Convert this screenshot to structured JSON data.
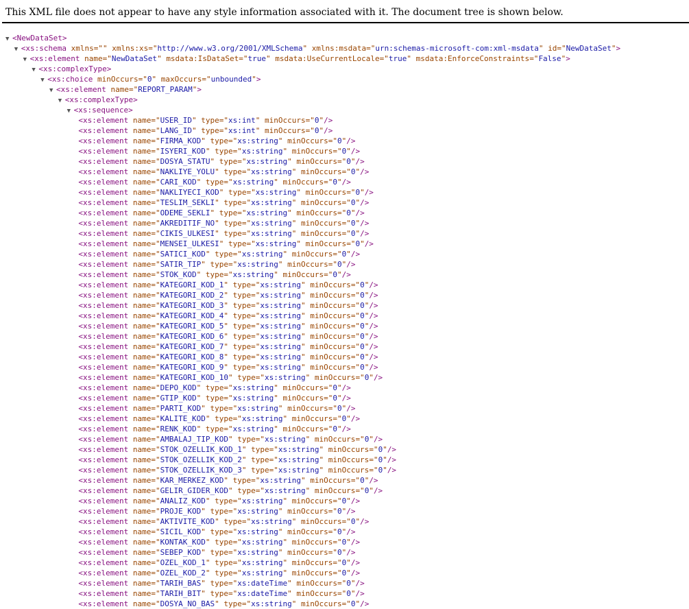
{
  "header": {
    "text": "This XML file does not appear to have any style information associated with it. The document tree is shown below."
  },
  "colors": {
    "tag": "#881280",
    "attribute": "#994500",
    "value": "#1a1aa6",
    "toggle": "#555555"
  },
  "icons": {
    "toggle": "triangle-down-icon"
  },
  "tree": {
    "lines": [
      {
        "indent": 0,
        "toggle": true,
        "tag": "NewDataSet",
        "attrs": [],
        "selfClose": false
      },
      {
        "indent": 1,
        "toggle": true,
        "tag": "xs:schema",
        "attrs": [
          [
            "xmlns",
            ""
          ],
          [
            "xmlns:xs",
            "http://www.w3.org/2001/XMLSchema"
          ],
          [
            "xmlns:msdata",
            "urn:schemas-microsoft-com:xml-msdata"
          ],
          [
            "id",
            "NewDataSet"
          ]
        ],
        "selfClose": false
      },
      {
        "indent": 2,
        "toggle": true,
        "tag": "xs:element",
        "attrs": [
          [
            "name",
            "NewDataSet"
          ],
          [
            "msdata:IsDataSet",
            "true"
          ],
          [
            "msdata:UseCurrentLocale",
            "true"
          ],
          [
            "msdata:EnforceConstraints",
            "False"
          ]
        ],
        "selfClose": false
      },
      {
        "indent": 3,
        "toggle": true,
        "tag": "xs:complexType",
        "attrs": [],
        "selfClose": false
      },
      {
        "indent": 4,
        "toggle": true,
        "tag": "xs:choice",
        "attrs": [
          [
            "minOccurs",
            "0"
          ],
          [
            "maxOccurs",
            "unbounded"
          ]
        ],
        "selfClose": false
      },
      {
        "indent": 5,
        "toggle": true,
        "tag": "xs:element",
        "attrs": [
          [
            "name",
            "REPORT_PARAM"
          ]
        ],
        "selfClose": false
      },
      {
        "indent": 6,
        "toggle": true,
        "tag": "xs:complexType",
        "attrs": [],
        "selfClose": false
      },
      {
        "indent": 7,
        "toggle": true,
        "tag": "xs:sequence",
        "attrs": [],
        "selfClose": false
      },
      {
        "indent": 8,
        "toggle": false,
        "tag": "xs:element",
        "attrs": [
          [
            "name",
            "USER_ID"
          ],
          [
            "type",
            "xs:int"
          ],
          [
            "minOccurs",
            "0"
          ]
        ],
        "selfClose": true
      },
      {
        "indent": 8,
        "toggle": false,
        "tag": "xs:element",
        "attrs": [
          [
            "name",
            "LANG_ID"
          ],
          [
            "type",
            "xs:int"
          ],
          [
            "minOccurs",
            "0"
          ]
        ],
        "selfClose": true
      },
      {
        "indent": 8,
        "toggle": false,
        "tag": "xs:element",
        "attrs": [
          [
            "name",
            "FIRMA_KOD"
          ],
          [
            "type",
            "xs:string"
          ],
          [
            "minOccurs",
            "0"
          ]
        ],
        "selfClose": true
      },
      {
        "indent": 8,
        "toggle": false,
        "tag": "xs:element",
        "attrs": [
          [
            "name",
            "ISYERI_KOD"
          ],
          [
            "type",
            "xs:string"
          ],
          [
            "minOccurs",
            "0"
          ]
        ],
        "selfClose": true
      },
      {
        "indent": 8,
        "toggle": false,
        "tag": "xs:element",
        "attrs": [
          [
            "name",
            "DOSYA_STATU"
          ],
          [
            "type",
            "xs:string"
          ],
          [
            "minOccurs",
            "0"
          ]
        ],
        "selfClose": true
      },
      {
        "indent": 8,
        "toggle": false,
        "tag": "xs:element",
        "attrs": [
          [
            "name",
            "NAKLIYE_YOLU"
          ],
          [
            "type",
            "xs:string"
          ],
          [
            "minOccurs",
            "0"
          ]
        ],
        "selfClose": true
      },
      {
        "indent": 8,
        "toggle": false,
        "tag": "xs:element",
        "attrs": [
          [
            "name",
            "CARI_KOD"
          ],
          [
            "type",
            "xs:string"
          ],
          [
            "minOccurs",
            "0"
          ]
        ],
        "selfClose": true
      },
      {
        "indent": 8,
        "toggle": false,
        "tag": "xs:element",
        "attrs": [
          [
            "name",
            "NAKLIYECI_KOD"
          ],
          [
            "type",
            "xs:string"
          ],
          [
            "minOccurs",
            "0"
          ]
        ],
        "selfClose": true
      },
      {
        "indent": 8,
        "toggle": false,
        "tag": "xs:element",
        "attrs": [
          [
            "name",
            "TESLIM_SEKLI"
          ],
          [
            "type",
            "xs:string"
          ],
          [
            "minOccurs",
            "0"
          ]
        ],
        "selfClose": true
      },
      {
        "indent": 8,
        "toggle": false,
        "tag": "xs:element",
        "attrs": [
          [
            "name",
            "ODEME_SEKLI"
          ],
          [
            "type",
            "xs:string"
          ],
          [
            "minOccurs",
            "0"
          ]
        ],
        "selfClose": true
      },
      {
        "indent": 8,
        "toggle": false,
        "tag": "xs:element",
        "attrs": [
          [
            "name",
            "AKREDITIF_NO"
          ],
          [
            "type",
            "xs:string"
          ],
          [
            "minOccurs",
            "0"
          ]
        ],
        "selfClose": true
      },
      {
        "indent": 8,
        "toggle": false,
        "tag": "xs:element",
        "attrs": [
          [
            "name",
            "CIKIS_ULKESI"
          ],
          [
            "type",
            "xs:string"
          ],
          [
            "minOccurs",
            "0"
          ]
        ],
        "selfClose": true
      },
      {
        "indent": 8,
        "toggle": false,
        "tag": "xs:element",
        "attrs": [
          [
            "name",
            "MENSEI_ULKESI"
          ],
          [
            "type",
            "xs:string"
          ],
          [
            "minOccurs",
            "0"
          ]
        ],
        "selfClose": true
      },
      {
        "indent": 8,
        "toggle": false,
        "tag": "xs:element",
        "attrs": [
          [
            "name",
            "SATICI_KOD"
          ],
          [
            "type",
            "xs:string"
          ],
          [
            "minOccurs",
            "0"
          ]
        ],
        "selfClose": true
      },
      {
        "indent": 8,
        "toggle": false,
        "tag": "xs:element",
        "attrs": [
          [
            "name",
            "SATIR_TIP"
          ],
          [
            "type",
            "xs:string"
          ],
          [
            "minOccurs",
            "0"
          ]
        ],
        "selfClose": true
      },
      {
        "indent": 8,
        "toggle": false,
        "tag": "xs:element",
        "attrs": [
          [
            "name",
            "STOK_KOD"
          ],
          [
            "type",
            "xs:string"
          ],
          [
            "minOccurs",
            "0"
          ]
        ],
        "selfClose": true
      },
      {
        "indent": 8,
        "toggle": false,
        "tag": "xs:element",
        "attrs": [
          [
            "name",
            "KATEGORI_KOD_1"
          ],
          [
            "type",
            "xs:string"
          ],
          [
            "minOccurs",
            "0"
          ]
        ],
        "selfClose": true
      },
      {
        "indent": 8,
        "toggle": false,
        "tag": "xs:element",
        "attrs": [
          [
            "name",
            "KATEGORI_KOD_2"
          ],
          [
            "type",
            "xs:string"
          ],
          [
            "minOccurs",
            "0"
          ]
        ],
        "selfClose": true
      },
      {
        "indent": 8,
        "toggle": false,
        "tag": "xs:element",
        "attrs": [
          [
            "name",
            "KATEGORI_KOD_3"
          ],
          [
            "type",
            "xs:string"
          ],
          [
            "minOccurs",
            "0"
          ]
        ],
        "selfClose": true
      },
      {
        "indent": 8,
        "toggle": false,
        "tag": "xs:element",
        "attrs": [
          [
            "name",
            "KATEGORI_KOD_4"
          ],
          [
            "type",
            "xs:string"
          ],
          [
            "minOccurs",
            "0"
          ]
        ],
        "selfClose": true
      },
      {
        "indent": 8,
        "toggle": false,
        "tag": "xs:element",
        "attrs": [
          [
            "name",
            "KATEGORI_KOD_5"
          ],
          [
            "type",
            "xs:string"
          ],
          [
            "minOccurs",
            "0"
          ]
        ],
        "selfClose": true
      },
      {
        "indent": 8,
        "toggle": false,
        "tag": "xs:element",
        "attrs": [
          [
            "name",
            "KATEGORI_KOD_6"
          ],
          [
            "type",
            "xs:string"
          ],
          [
            "minOccurs",
            "0"
          ]
        ],
        "selfClose": true
      },
      {
        "indent": 8,
        "toggle": false,
        "tag": "xs:element",
        "attrs": [
          [
            "name",
            "KATEGORI_KOD_7"
          ],
          [
            "type",
            "xs:string"
          ],
          [
            "minOccurs",
            "0"
          ]
        ],
        "selfClose": true
      },
      {
        "indent": 8,
        "toggle": false,
        "tag": "xs:element",
        "attrs": [
          [
            "name",
            "KATEGORI_KOD_8"
          ],
          [
            "type",
            "xs:string"
          ],
          [
            "minOccurs",
            "0"
          ]
        ],
        "selfClose": true
      },
      {
        "indent": 8,
        "toggle": false,
        "tag": "xs:element",
        "attrs": [
          [
            "name",
            "KATEGORI_KOD_9"
          ],
          [
            "type",
            "xs:string"
          ],
          [
            "minOccurs",
            "0"
          ]
        ],
        "selfClose": true
      },
      {
        "indent": 8,
        "toggle": false,
        "tag": "xs:element",
        "attrs": [
          [
            "name",
            "KATEGORI_KOD_10"
          ],
          [
            "type",
            "xs:string"
          ],
          [
            "minOccurs",
            "0"
          ]
        ],
        "selfClose": true
      },
      {
        "indent": 8,
        "toggle": false,
        "tag": "xs:element",
        "attrs": [
          [
            "name",
            "DEPO_KOD"
          ],
          [
            "type",
            "xs:string"
          ],
          [
            "minOccurs",
            "0"
          ]
        ],
        "selfClose": true
      },
      {
        "indent": 8,
        "toggle": false,
        "tag": "xs:element",
        "attrs": [
          [
            "name",
            "GTIP_KOD"
          ],
          [
            "type",
            "xs:string"
          ],
          [
            "minOccurs",
            "0"
          ]
        ],
        "selfClose": true
      },
      {
        "indent": 8,
        "toggle": false,
        "tag": "xs:element",
        "attrs": [
          [
            "name",
            "PARTI_KOD"
          ],
          [
            "type",
            "xs:string"
          ],
          [
            "minOccurs",
            "0"
          ]
        ],
        "selfClose": true
      },
      {
        "indent": 8,
        "toggle": false,
        "tag": "xs:element",
        "attrs": [
          [
            "name",
            "KALITE_KOD"
          ],
          [
            "type",
            "xs:string"
          ],
          [
            "minOccurs",
            "0"
          ]
        ],
        "selfClose": true
      },
      {
        "indent": 8,
        "toggle": false,
        "tag": "xs:element",
        "attrs": [
          [
            "name",
            "RENK_KOD"
          ],
          [
            "type",
            "xs:string"
          ],
          [
            "minOccurs",
            "0"
          ]
        ],
        "selfClose": true
      },
      {
        "indent": 8,
        "toggle": false,
        "tag": "xs:element",
        "attrs": [
          [
            "name",
            "AMBALAJ_TIP_KOD"
          ],
          [
            "type",
            "xs:string"
          ],
          [
            "minOccurs",
            "0"
          ]
        ],
        "selfClose": true
      },
      {
        "indent": 8,
        "toggle": false,
        "tag": "xs:element",
        "attrs": [
          [
            "name",
            "STOK_OZELLIK_KOD_1"
          ],
          [
            "type",
            "xs:string"
          ],
          [
            "minOccurs",
            "0"
          ]
        ],
        "selfClose": true
      },
      {
        "indent": 8,
        "toggle": false,
        "tag": "xs:element",
        "attrs": [
          [
            "name",
            "STOK_OZELLIK_KOD_2"
          ],
          [
            "type",
            "xs:string"
          ],
          [
            "minOccurs",
            "0"
          ]
        ],
        "selfClose": true
      },
      {
        "indent": 8,
        "toggle": false,
        "tag": "xs:element",
        "attrs": [
          [
            "name",
            "STOK_OZELLIK_KOD_3"
          ],
          [
            "type",
            "xs:string"
          ],
          [
            "minOccurs",
            "0"
          ]
        ],
        "selfClose": true
      },
      {
        "indent": 8,
        "toggle": false,
        "tag": "xs:element",
        "attrs": [
          [
            "name",
            "KAR_MERKEZ_KOD"
          ],
          [
            "type",
            "xs:string"
          ],
          [
            "minOccurs",
            "0"
          ]
        ],
        "selfClose": true
      },
      {
        "indent": 8,
        "toggle": false,
        "tag": "xs:element",
        "attrs": [
          [
            "name",
            "GELIR_GIDER_KOD"
          ],
          [
            "type",
            "xs:string"
          ],
          [
            "minOccurs",
            "0"
          ]
        ],
        "selfClose": true
      },
      {
        "indent": 8,
        "toggle": false,
        "tag": "xs:element",
        "attrs": [
          [
            "name",
            "ANALIZ_KOD"
          ],
          [
            "type",
            "xs:string"
          ],
          [
            "minOccurs",
            "0"
          ]
        ],
        "selfClose": true
      },
      {
        "indent": 8,
        "toggle": false,
        "tag": "xs:element",
        "attrs": [
          [
            "name",
            "PROJE_KOD"
          ],
          [
            "type",
            "xs:string"
          ],
          [
            "minOccurs",
            "0"
          ]
        ],
        "selfClose": true
      },
      {
        "indent": 8,
        "toggle": false,
        "tag": "xs:element",
        "attrs": [
          [
            "name",
            "AKTIVITE_KOD"
          ],
          [
            "type",
            "xs:string"
          ],
          [
            "minOccurs",
            "0"
          ]
        ],
        "selfClose": true
      },
      {
        "indent": 8,
        "toggle": false,
        "tag": "xs:element",
        "attrs": [
          [
            "name",
            "SICIL_KOD"
          ],
          [
            "type",
            "xs:string"
          ],
          [
            "minOccurs",
            "0"
          ]
        ],
        "selfClose": true
      },
      {
        "indent": 8,
        "toggle": false,
        "tag": "xs:element",
        "attrs": [
          [
            "name",
            "KONTAK_KOD"
          ],
          [
            "type",
            "xs:string"
          ],
          [
            "minOccurs",
            "0"
          ]
        ],
        "selfClose": true
      },
      {
        "indent": 8,
        "toggle": false,
        "tag": "xs:element",
        "attrs": [
          [
            "name",
            "SEBEP_KOD"
          ],
          [
            "type",
            "xs:string"
          ],
          [
            "minOccurs",
            "0"
          ]
        ],
        "selfClose": true
      },
      {
        "indent": 8,
        "toggle": false,
        "tag": "xs:element",
        "attrs": [
          [
            "name",
            "OZEL_KOD_1"
          ],
          [
            "type",
            "xs:string"
          ],
          [
            "minOccurs",
            "0"
          ]
        ],
        "selfClose": true
      },
      {
        "indent": 8,
        "toggle": false,
        "tag": "xs:element",
        "attrs": [
          [
            "name",
            "OZEL_KOD_2"
          ],
          [
            "type",
            "xs:string"
          ],
          [
            "minOccurs",
            "0"
          ]
        ],
        "selfClose": true
      },
      {
        "indent": 8,
        "toggle": false,
        "tag": "xs:element",
        "attrs": [
          [
            "name",
            "TARIH_BAS"
          ],
          [
            "type",
            "xs:dateTime"
          ],
          [
            "minOccurs",
            "0"
          ]
        ],
        "selfClose": true
      },
      {
        "indent": 8,
        "toggle": false,
        "tag": "xs:element",
        "attrs": [
          [
            "name",
            "TARIH_BIT"
          ],
          [
            "type",
            "xs:dateTime"
          ],
          [
            "minOccurs",
            "0"
          ]
        ],
        "selfClose": true
      },
      {
        "indent": 8,
        "toggle": false,
        "tag": "xs:element",
        "attrs": [
          [
            "name",
            "DOSYA_NO_BAS"
          ],
          [
            "type",
            "xs:string"
          ],
          [
            "minOccurs",
            "0"
          ]
        ],
        "selfClose": true
      }
    ]
  }
}
